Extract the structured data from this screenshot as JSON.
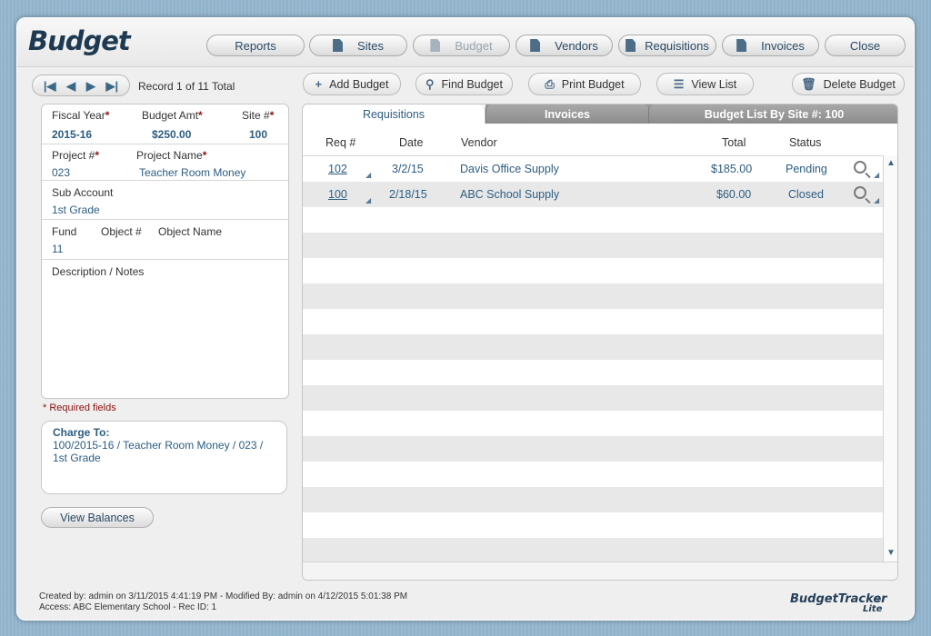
{
  "app": {
    "title": "Budget"
  },
  "topnav": [
    {
      "label": "Reports",
      "icon": "none",
      "enabled": true
    },
    {
      "label": "Sites",
      "icon": "document-icon",
      "enabled": true
    },
    {
      "label": "Budget",
      "icon": "document-icon",
      "enabled": false
    },
    {
      "label": "Vendors",
      "icon": "document-icon",
      "enabled": true
    },
    {
      "label": "Requisitions",
      "icon": "document-icon",
      "enabled": true
    },
    {
      "label": "Invoices",
      "icon": "document-icon",
      "enabled": true
    },
    {
      "label": "Close",
      "icon": "none",
      "enabled": true
    }
  ],
  "record": {
    "info": "Record 1 of 11 Total"
  },
  "actions": {
    "add": "Add Budget",
    "find": "Find Budget",
    "print": "Print Budget",
    "view_list": "View List",
    "delete": "Delete Budget"
  },
  "form": {
    "fiscal_year_label": "Fiscal Year",
    "fiscal_year": "2015-16",
    "budget_amt_label": "Budget Amt",
    "budget_amt": "$250.00",
    "site_label": "Site #",
    "site": "100",
    "project_no_label": "Project #",
    "project_no": "023",
    "project_name_label": "Project Name",
    "project_name": "Teacher Room Money",
    "sub_account_label": "Sub Account",
    "sub_account": "1st Grade",
    "fund_label": "Fund",
    "fund": "11",
    "object_no_label": "Object #",
    "object_name_label": "Object Name",
    "description_label": "Description / Notes",
    "required_asterisk": "*"
  },
  "required_note": "* Required fields",
  "charge": {
    "title": "Charge To:",
    "line1": "100/2015-16 / Teacher Room Money / 023 /",
    "line2": "1st Grade"
  },
  "view_balances": "View Balances",
  "tabs": [
    {
      "label": "Requisitions",
      "active": true
    },
    {
      "label": "Invoices",
      "active": false
    },
    {
      "label": "Budget List By Site #: 100",
      "active": false
    }
  ],
  "table": {
    "headers": {
      "req": "Req #",
      "date": "Date",
      "vendor": "Vendor",
      "total": "Total",
      "status": "Status"
    },
    "rows": [
      {
        "req": "102",
        "date": "3/2/15",
        "vendor": "Davis Office Supply",
        "total": "$185.00",
        "status": "Pending"
      },
      {
        "req": "100",
        "date": "2/18/15",
        "vendor": "ABC School Supply",
        "total": "$60.00",
        "status": "Closed"
      }
    ]
  },
  "footer": {
    "line1": "Created by: admin on 3/11/2015 4:41:19 PM - Modified By: admin on 4/12/2015 5:01:38 PM",
    "line2": "Access: ABC Elementary School - Rec ID: 1",
    "brand": "BudgetTracker",
    "brand_sub": "Lite",
    "brand_mark": "®"
  },
  "colors": {
    "accent": "#2c5d82",
    "required": "#8a1010",
    "background": "#9dbcd2"
  }
}
